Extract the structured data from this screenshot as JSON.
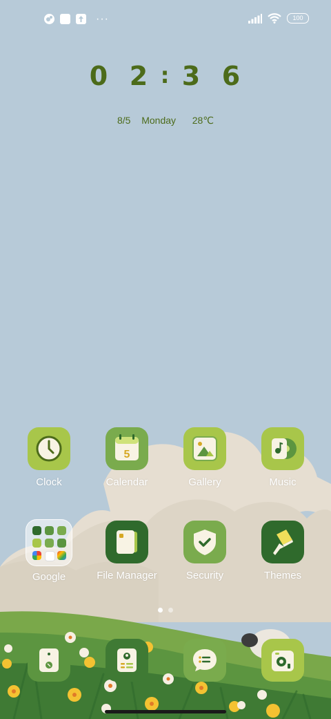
{
  "status_bar": {
    "left_icons": [
      "notification-icon",
      "square-icon",
      "upload-icon"
    ],
    "more_dots": "···",
    "battery_level": "100",
    "right_icons": [
      "signal-icon",
      "wifi-icon",
      "battery-icon"
    ]
  },
  "clock": {
    "h1": "0",
    "h2": "2",
    "colon": ":",
    "m1": "3",
    "m2": "6"
  },
  "date": {
    "text": "8/5  Monday   28℃"
  },
  "apps": {
    "clock": "Clock",
    "calendar": "Calendar",
    "calendar_day": "5",
    "gallery": "Gallery",
    "music": "Music",
    "google": "Google",
    "file_manager": "File Manager",
    "security": "Security",
    "themes": "Themes"
  },
  "dock": [
    "phone",
    "contacts",
    "messages",
    "camera"
  ],
  "pager": {
    "pages": 2,
    "current": 1
  },
  "colors": {
    "accent_dark": "#4c6b1a",
    "icon_lime": "#a8c64a",
    "icon_green": "#6c9a3a",
    "icon_deep": "#2f6a2c",
    "sky": "#b6cad8"
  }
}
